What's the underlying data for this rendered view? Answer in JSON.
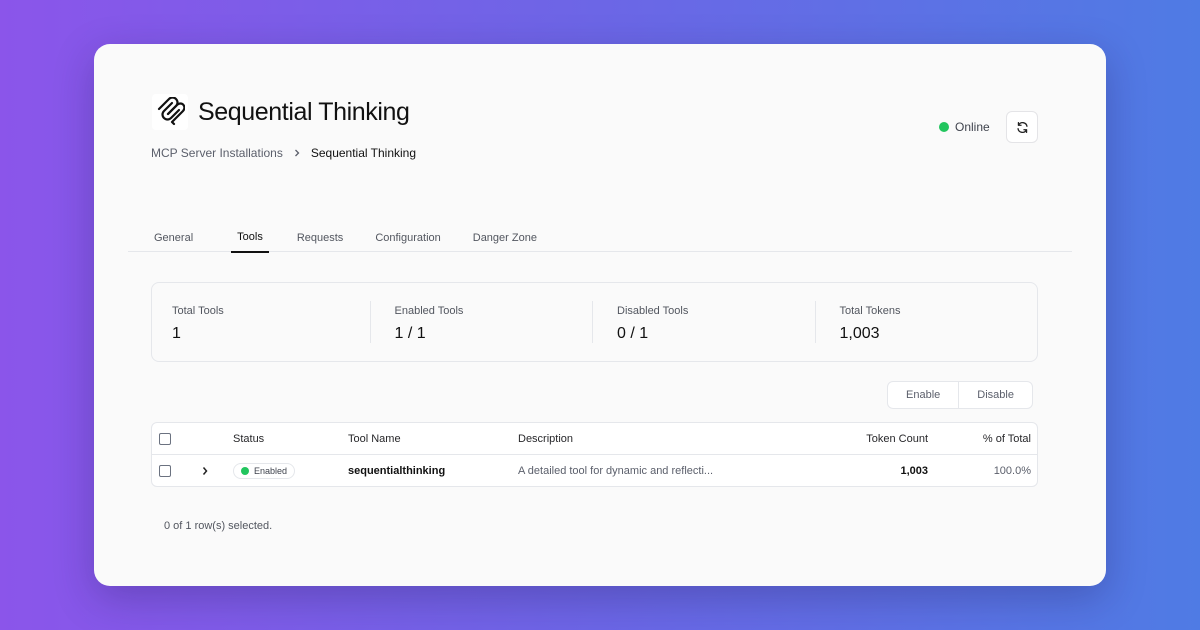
{
  "header": {
    "title": "Sequential Thinking",
    "logo_icon": "mcp-logo-icon"
  },
  "breadcrumb": {
    "parent": "MCP Server Installations",
    "current": "Sequential Thinking"
  },
  "status": {
    "label": "Online",
    "color": "#22c55e"
  },
  "tabs": [
    {
      "label": "General",
      "active": false
    },
    {
      "label": "Tools",
      "active": true
    },
    {
      "label": "Requests",
      "active": false
    },
    {
      "label": "Configuration",
      "active": false
    },
    {
      "label": "Danger Zone",
      "active": false
    }
  ],
  "stats": [
    {
      "label": "Total Tools",
      "value": "1"
    },
    {
      "label": "Enabled Tools",
      "value": "1 / 1"
    },
    {
      "label": "Disabled Tools",
      "value": "0 / 1"
    },
    {
      "label": "Total Tokens",
      "value": "1,003"
    }
  ],
  "actions": {
    "enable": "Enable",
    "disable": "Disable"
  },
  "table": {
    "columns": {
      "status": "Status",
      "tool_name": "Tool Name",
      "description": "Description",
      "token_count": "Token Count",
      "percent": "% of Total"
    },
    "rows": [
      {
        "status": "Enabled",
        "tool_name": "sequentialthinking",
        "description": "A detailed tool for dynamic and reflecti...",
        "token_count": "1,003",
        "percent": "100.0%"
      }
    ]
  },
  "footer": {
    "selection": "0 of 1 row(s) selected."
  }
}
